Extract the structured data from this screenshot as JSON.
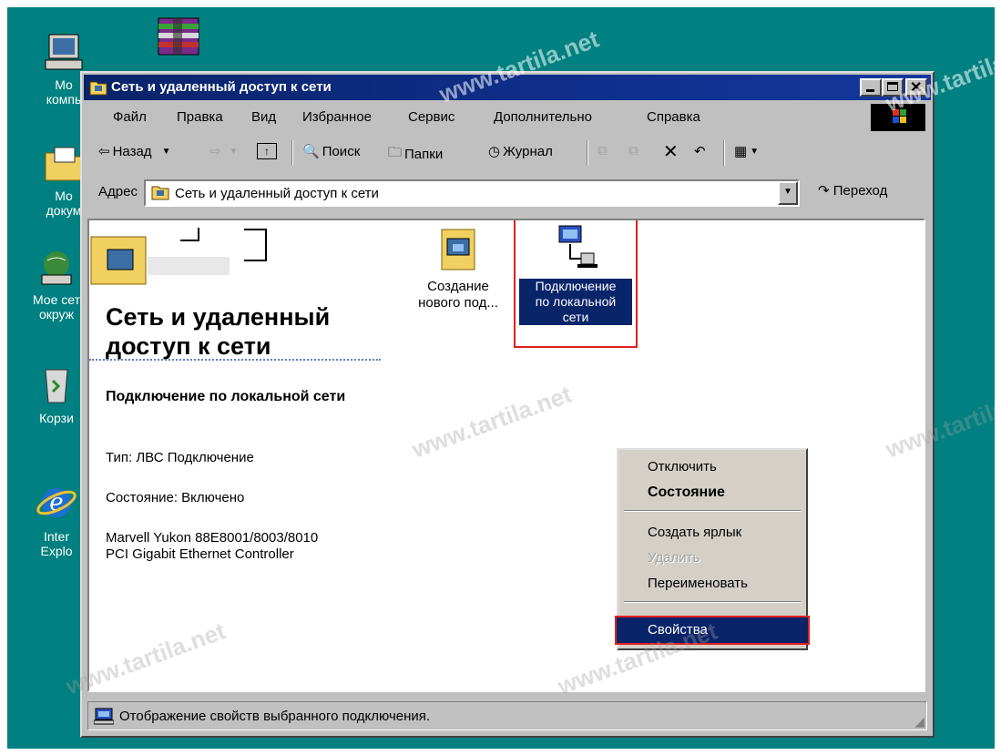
{
  "desktop": {
    "icons": [
      {
        "label_line1": "Мо",
        "label_line2": "компь",
        "icon": "computer-icon"
      },
      {
        "label_line1": "Мо",
        "label_line2": "докум",
        "icon": "documents-folder-icon"
      },
      {
        "label_line1": "Мое сет",
        "label_line2": "окруж",
        "icon": "network-neighborhood-icon"
      },
      {
        "label_line1": "Корзи",
        "label_line2": "",
        "icon": "recycle-bin-icon"
      },
      {
        "label_line1": "Inter",
        "label_line2": "Explo",
        "icon": "internet-explorer-icon"
      }
    ],
    "top_icon": "winrar-icon",
    "watermark": "www.tartila.net"
  },
  "window": {
    "title": "Сеть и удаленный доступ к сети",
    "menu": [
      "Файл",
      "Правка",
      "Вид",
      "Избранное",
      "Сервис",
      "Дополнительно",
      "Справка"
    ],
    "toolbar": {
      "back": "Назад",
      "search": "Поиск",
      "folders": "Папки",
      "history": "Журнал"
    },
    "address": {
      "label": "Адрес",
      "value": "Сеть и удаленный доступ к сети",
      "go": "Переход"
    },
    "left_panel": {
      "title": "Сеть и удаленный доступ к сети",
      "selected_name": "Подключение по локальной сети",
      "type": "Тип: ЛВС Подключение",
      "status": "Состояние: Включено",
      "adapter_line1": "Marvell Yukon 88E8001/8003/8010",
      "adapter_line2": "PCI Gigabit Ethernet Controller"
    },
    "items": [
      {
        "line1": "Создание",
        "line2": "нового под...",
        "icon": "new-connection-icon"
      },
      {
        "line1": "Подключение",
        "line2": "по локальной",
        "line3": "сети",
        "icon": "lan-connection-icon"
      }
    ],
    "context_menu": {
      "items": [
        "Отключить",
        "Состояние",
        "Создать ярлык",
        "Удалить",
        "Переименовать",
        "Свойства"
      ]
    },
    "status_text": "Отображение свойств выбранного подключения."
  },
  "colors": {
    "title_bar": "#0a246a",
    "selection": "#0a246a",
    "highlight_border": "#e02020",
    "desktop": "#008080"
  }
}
